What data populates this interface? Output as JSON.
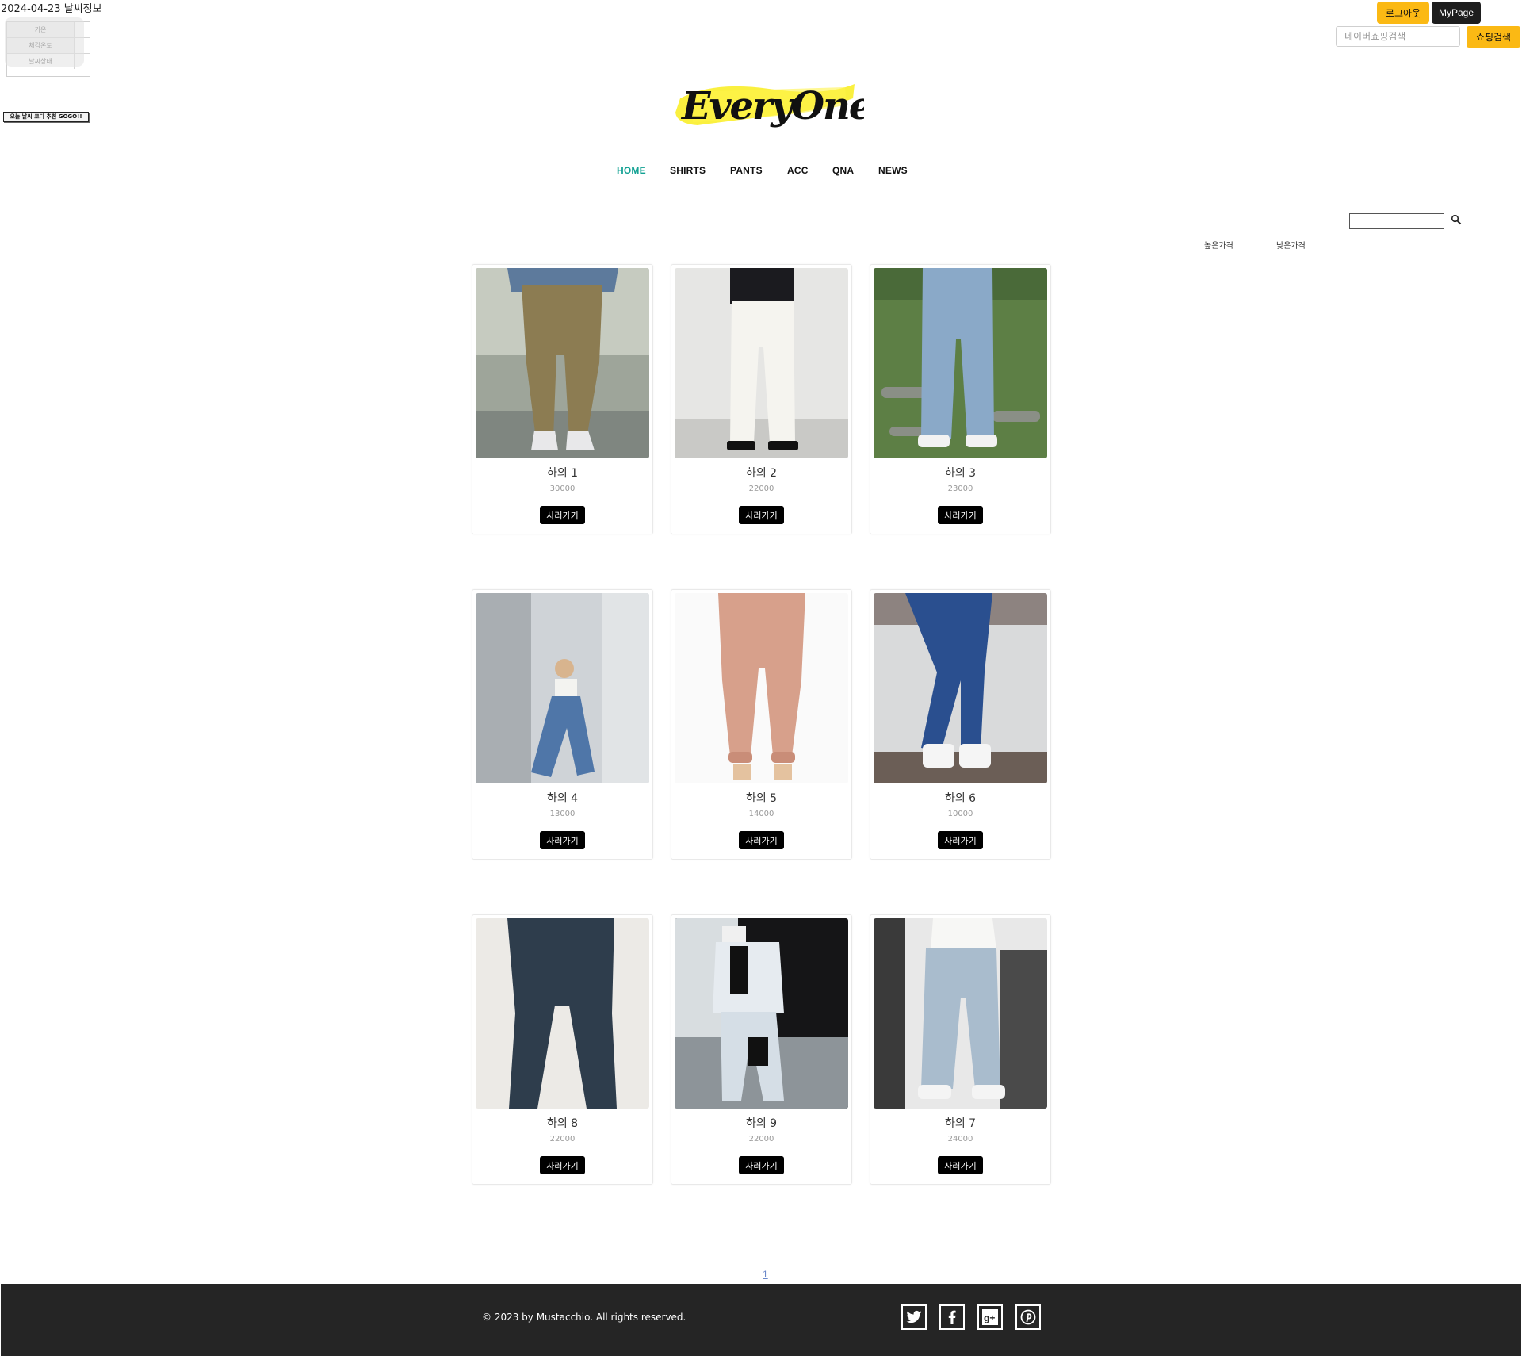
{
  "weather": {
    "date": "2024-04-23",
    "title_suffix": "날씨정보",
    "rows": [
      {
        "label": "기온",
        "value": ""
      },
      {
        "label": "체감온도",
        "value": ""
      },
      {
        "label": "날씨상태",
        "value": ""
      }
    ],
    "coordi_button": "오늘 날씨 코디 추천 GOGO!!"
  },
  "header": {
    "logout": "로그아웃",
    "mypage": "MyPage",
    "naver_search_placeholder": "네이버쇼핑검색",
    "shop_search": "쇼핑검색",
    "logo_text": "EveryOne",
    "accent_color": "#fbb914"
  },
  "nav": {
    "items": [
      "HOME",
      "SHIRTS",
      "PANTS",
      "ACC",
      "QNA",
      "NEWS"
    ],
    "active": "HOME",
    "active_color": "#12a193"
  },
  "product_tools": {
    "search_value": "",
    "sort_high": "높은가격",
    "sort_low": "낮은가격"
  },
  "products": [
    {
      "name": "하의 1",
      "price": "30000",
      "buy": "사러가기",
      "photo": "khaki-jogger-pants"
    },
    {
      "name": "하의 2",
      "price": "22000",
      "buy": "사러가기",
      "photo": "white-straight-pants"
    },
    {
      "name": "하의 3",
      "price": "23000",
      "buy": "사러가기",
      "photo": "light-wide-jeans"
    },
    {
      "name": "하의 4",
      "price": "13000",
      "buy": "사러가기",
      "photo": "patterned-denim-pants"
    },
    {
      "name": "하의 5",
      "price": "14000",
      "buy": "사러가기",
      "photo": "pink-jogger-pants"
    },
    {
      "name": "하의 6",
      "price": "10000",
      "buy": "사러가기",
      "photo": "ripped-skinny-jeans"
    },
    {
      "name": "하의 8",
      "price": "22000",
      "buy": "사러가기",
      "photo": "dark-denim-flatlay"
    },
    {
      "name": "하의 9",
      "price": "22000",
      "buy": "사러가기",
      "photo": "black-white-track-pants"
    },
    {
      "name": "하의 7",
      "price": "24000",
      "buy": "사러가기",
      "photo": "washed-wide-jeans"
    }
  ],
  "pagination": {
    "pages": [
      "1"
    ],
    "current": "1"
  },
  "footer": {
    "copyright": "© 2023 by Mustacchio. All rights reserved.",
    "social": [
      "twitter-icon",
      "facebook-icon",
      "google-plus-icon",
      "pinterest-icon"
    ],
    "background": "#252525"
  }
}
